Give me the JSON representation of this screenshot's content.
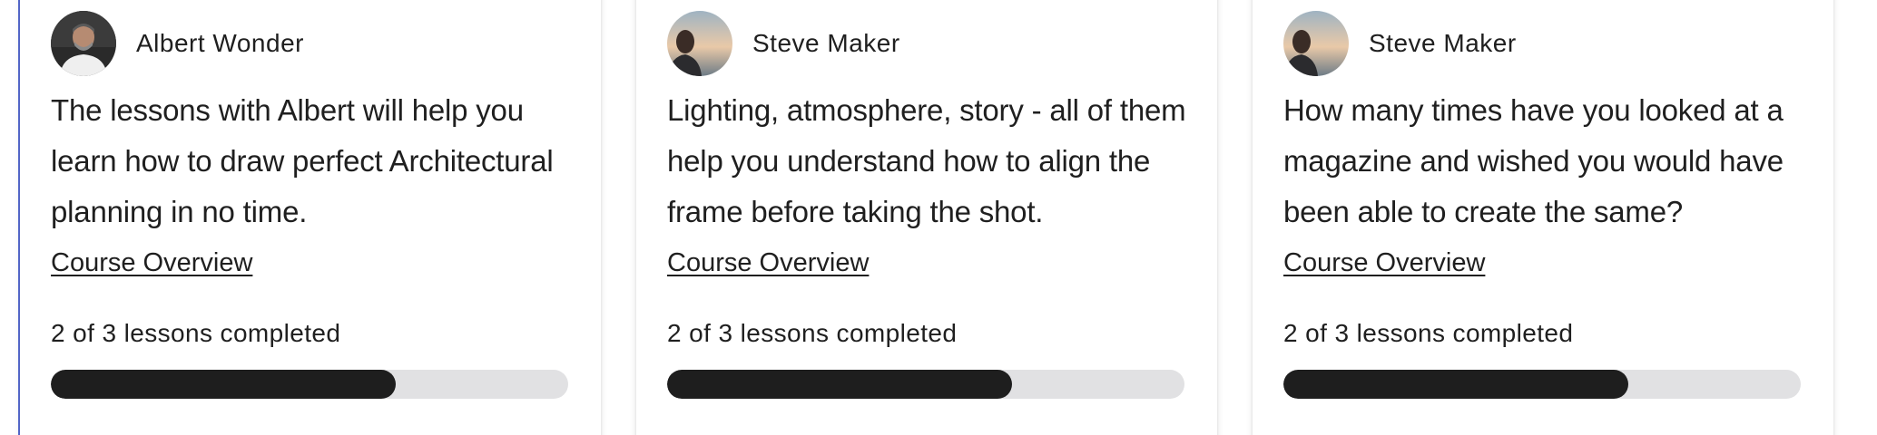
{
  "courses": [
    {
      "author": "Albert Wonder",
      "avatar_icon": "person-portrait-icon",
      "description": "The lessons with Albert will help you learn how to draw perfect Architectural planning in no time.",
      "link_label": "Course Overview",
      "progress_text": "2 of 3 lessons completed",
      "progress_fraction": 0.6667
    },
    {
      "author": "Steve Maker",
      "avatar_icon": "person-portrait-icon",
      "description": "Lighting, atmosphere, story - all of them help you understand how to align the frame before taking the shot.",
      "link_label": "Course Overview",
      "progress_text": "2 of 3 lessons completed",
      "progress_fraction": 0.6667
    },
    {
      "author": "Steve Maker",
      "avatar_icon": "person-portrait-icon",
      "description": "How many times have you looked at a magazine and wished you would have been able to create the same?",
      "link_label": "Course Overview",
      "progress_text": "2 of 3 lessons completed",
      "progress_fraction": 0.6667
    }
  ],
  "colors": {
    "progress_fill": "#1e1e1e",
    "progress_track": "#e1e1e3",
    "focus_outline": "#5a6fd6"
  }
}
